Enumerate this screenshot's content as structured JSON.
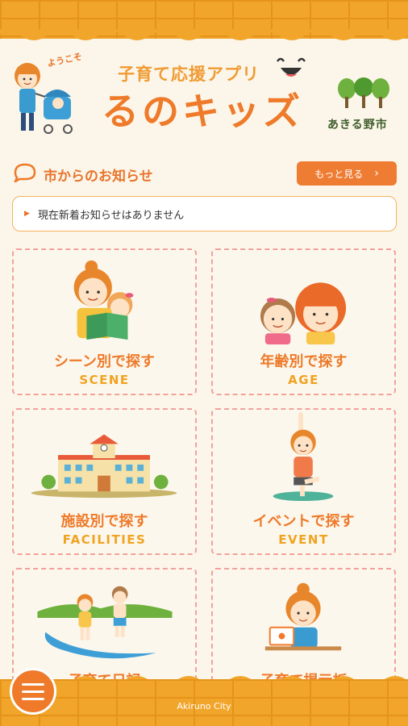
{
  "header": {
    "welcome": "ようこそ",
    "subtitle": "子育て応援アプリ",
    "title": "るのキッズ",
    "city": "あきる野市"
  },
  "notice": {
    "title": "市からのお知らせ",
    "more_label": "もっと見る",
    "message": "現在新着お知らせはありません"
  },
  "tiles": [
    {
      "label": "シーン別で探す",
      "sub": "SCENE"
    },
    {
      "label": "年齢別で探す",
      "sub": "AGE"
    },
    {
      "label": "施設別で探す",
      "sub": "FACILITIES"
    },
    {
      "label": "イベントで探す",
      "sub": "EVENT"
    },
    {
      "label": "子育て日記",
      "sub": ""
    },
    {
      "label": "子育て掲示板",
      "sub": ""
    }
  ],
  "footer": {
    "city": "Akiruno City"
  },
  "colors": {
    "accent": "#ee7a2a",
    "brick": "#f1a52a",
    "background": "#fbf6e9",
    "tile_border": "#f2a29a"
  }
}
